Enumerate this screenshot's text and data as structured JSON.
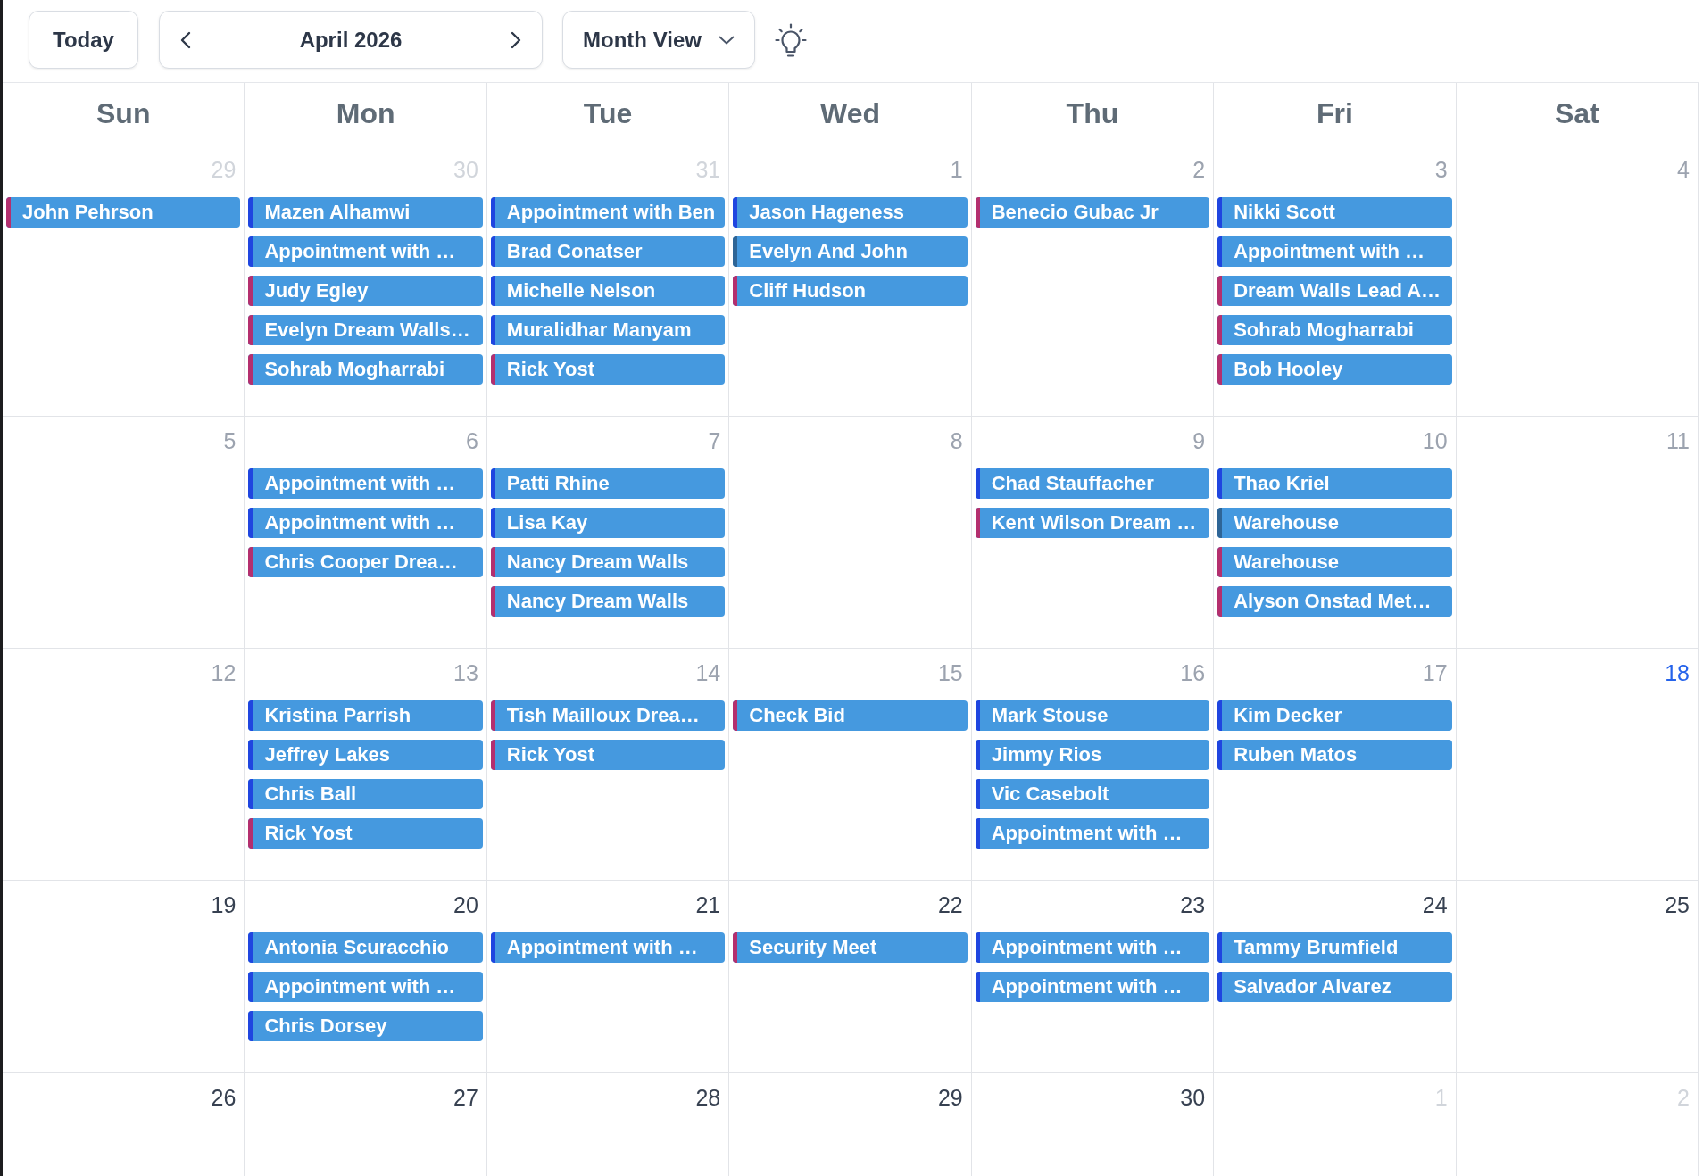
{
  "toolbar": {
    "today_button": "Today",
    "month_label": "April 2026",
    "view_dropdown": "Month View"
  },
  "calendar": {
    "weekdays": [
      "Sun",
      "Mon",
      "Tue",
      "Wed",
      "Thu",
      "Fri",
      "Sat"
    ],
    "weeks": [
      {
        "days": [
          {
            "date": "29",
            "kind": "outside",
            "events": [
              {
                "title": "John Pehrson",
                "color": "#b42f6e"
              }
            ]
          },
          {
            "date": "30",
            "kind": "outside",
            "events": [
              {
                "title": "Mazen Alhamwi",
                "color": "#1f45e0"
              },
              {
                "title": "Appointment with …",
                "color": "#1f45e0"
              },
              {
                "title": "Judy Egley",
                "color": "#b42f6e"
              },
              {
                "title": "Evelyn Dream Walls…",
                "color": "#b42f6e"
              },
              {
                "title": "Sohrab Mogharrabi",
                "color": "#b42f6e"
              }
            ]
          },
          {
            "date": "31",
            "kind": "outside",
            "events": [
              {
                "title": "Appointment with Ben",
                "color": "#1f45e0"
              },
              {
                "title": "Brad Conatser",
                "color": "#1f45e0"
              },
              {
                "title": "Michelle Nelson",
                "color": "#1f45e0"
              },
              {
                "title": "Muralidhar Manyam",
                "color": "#1f45e0"
              },
              {
                "title": "Rick Yost",
                "color": "#b42f6e"
              }
            ]
          },
          {
            "date": "1",
            "kind": "past",
            "events": [
              {
                "title": "Jason Hageness",
                "color": "#1f45e0"
              },
              {
                "title": "Evelyn And John",
                "color": "#2e6596"
              },
              {
                "title": "Cliff Hudson",
                "color": "#b42f6e"
              }
            ]
          },
          {
            "date": "2",
            "kind": "past",
            "events": [
              {
                "title": "Benecio Gubac Jr",
                "color": "#b42f6e"
              }
            ]
          },
          {
            "date": "3",
            "kind": "past",
            "events": [
              {
                "title": "Nikki Scott",
                "color": "#1f45e0"
              },
              {
                "title": "Appointment with …",
                "color": "#1f45e0"
              },
              {
                "title": "Dream Walls Lead A…",
                "color": "#b42f6e"
              },
              {
                "title": "Sohrab Mogharrabi",
                "color": "#b42f6e"
              },
              {
                "title": "Bob Hooley",
                "color": "#b42f6e"
              }
            ]
          },
          {
            "date": "4",
            "kind": "past"
          }
        ]
      },
      {
        "days": [
          {
            "date": "5",
            "kind": "past"
          },
          {
            "date": "6",
            "kind": "past",
            "events": [
              {
                "title": "Appointment with …",
                "color": "#1f45e0"
              },
              {
                "title": "Appointment with …",
                "color": "#1f45e0"
              },
              {
                "title": "Chris Cooper Drea…",
                "color": "#b42f6e"
              }
            ]
          },
          {
            "date": "7",
            "kind": "past",
            "events": [
              {
                "title": "Patti Rhine",
                "color": "#1f45e0"
              },
              {
                "title": "Lisa Kay",
                "color": "#1f45e0"
              },
              {
                "title": "Nancy Dream Walls",
                "color": "#b42f6e"
              },
              {
                "title": "Nancy Dream Walls",
                "color": "#b42f6e"
              }
            ]
          },
          {
            "date": "8",
            "kind": "past"
          },
          {
            "date": "9",
            "kind": "past",
            "events": [
              {
                "title": "Chad Stauffacher",
                "color": "#1f45e0"
              },
              {
                "title": "Kent Wilson Dream …",
                "color": "#b42f6e"
              }
            ]
          },
          {
            "date": "10",
            "kind": "past",
            "events": [
              {
                "title": "Thao Kriel",
                "color": "#1f45e0"
              },
              {
                "title": "Warehouse",
                "color": "#2e6596"
              },
              {
                "title": "Warehouse",
                "color": "#b42f6e"
              },
              {
                "title": "Alyson Onstad Met…",
                "color": "#b42f6e"
              }
            ]
          },
          {
            "date": "11",
            "kind": "past"
          }
        ]
      },
      {
        "days": [
          {
            "date": "12",
            "kind": "past"
          },
          {
            "date": "13",
            "kind": "past",
            "events": [
              {
                "title": "Kristina Parrish",
                "color": "#1f45e0"
              },
              {
                "title": "Jeffrey Lakes",
                "color": "#1f45e0"
              },
              {
                "title": "Chris Ball",
                "color": "#1f45e0"
              },
              {
                "title": "Rick Yost",
                "color": "#b42f6e"
              }
            ]
          },
          {
            "date": "14",
            "kind": "past",
            "events": [
              {
                "title": "Tish Mailloux Drea…",
                "color": "#b42f6e"
              },
              {
                "title": "Rick Yost",
                "color": "#b42f6e"
              }
            ]
          },
          {
            "date": "15",
            "kind": "past",
            "events": [
              {
                "title": "Check Bid",
                "color": "#b42f6e"
              }
            ]
          },
          {
            "date": "16",
            "kind": "past",
            "events": [
              {
                "title": "Mark Stouse",
                "color": "#1f45e0"
              },
              {
                "title": "Jimmy Rios",
                "color": "#1f45e0"
              },
              {
                "title": "Vic Casebolt",
                "color": "#1f45e0"
              },
              {
                "title": "Appointment with …",
                "color": "#1f45e0"
              }
            ]
          },
          {
            "date": "17",
            "kind": "past",
            "events": [
              {
                "title": "Kim Decker",
                "color": "#1f45e0"
              },
              {
                "title": "Ruben Matos",
                "color": "#1f45e0"
              }
            ]
          },
          {
            "date": "18",
            "kind": "today"
          }
        ]
      },
      {
        "days": [
          {
            "date": "19",
            "kind": "upcoming"
          },
          {
            "date": "20",
            "kind": "upcoming",
            "events": [
              {
                "title": "Antonia Scuracchio",
                "color": "#1f45e0"
              },
              {
                "title": "Appointment with …",
                "color": "#1f45e0"
              },
              {
                "title": "Chris Dorsey",
                "color": "#1f45e0"
              }
            ]
          },
          {
            "date": "21",
            "kind": "upcoming",
            "events": [
              {
                "title": "Appointment with …",
                "color": "#1f45e0"
              }
            ]
          },
          {
            "date": "22",
            "kind": "upcoming",
            "events": [
              {
                "title": "Security Meet",
                "color": "#b42f6e"
              }
            ]
          },
          {
            "date": "23",
            "kind": "upcoming",
            "events": [
              {
                "title": "Appointment with …",
                "color": "#1f45e0"
              },
              {
                "title": "Appointment with …",
                "color": "#1f45e0"
              }
            ]
          },
          {
            "date": "24",
            "kind": "upcoming",
            "events": [
              {
                "title": "Tammy Brumfield",
                "color": "#1f45e0"
              },
              {
                "title": "Salvador Alvarez",
                "color": "#1f45e0"
              }
            ]
          },
          {
            "date": "25",
            "kind": "upcoming"
          }
        ]
      },
      {
        "days": [
          {
            "date": "26",
            "kind": "upcoming"
          },
          {
            "date": "27",
            "kind": "upcoming"
          },
          {
            "date": "28",
            "kind": "upcoming"
          },
          {
            "date": "29",
            "kind": "upcoming"
          },
          {
            "date": "30",
            "kind": "upcoming"
          },
          {
            "date": "1",
            "kind": "outside"
          },
          {
            "date": "2",
            "kind": "outside"
          }
        ]
      }
    ]
  }
}
